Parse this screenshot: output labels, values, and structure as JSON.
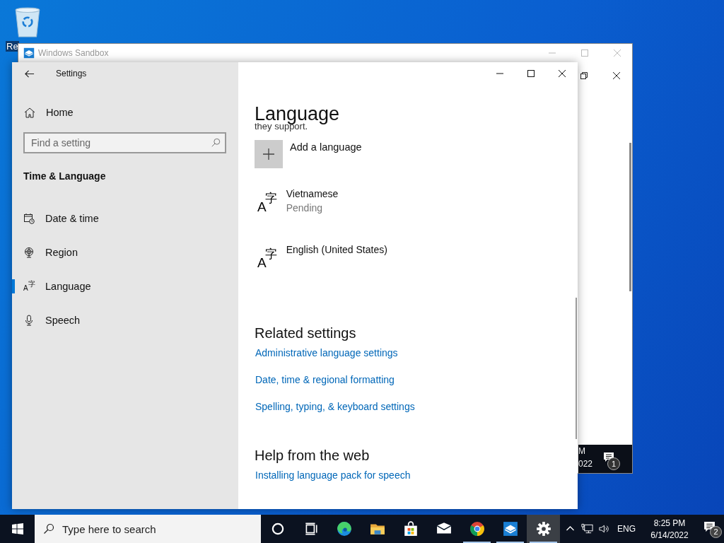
{
  "desktop": {
    "icons": [
      {
        "label": "Re"
      }
    ]
  },
  "sandbox_window": {
    "title": "Windows Sandbox",
    "inner_taskbar": {
      "time": "M",
      "date": "022",
      "notification_count": "1"
    }
  },
  "settings_window": {
    "title": "Settings",
    "sidebar": {
      "home": "Home",
      "search": {
        "placeholder": "Find a setting"
      },
      "section": "Time & Language",
      "items": [
        {
          "label": "Date & time",
          "kind": "clock",
          "selected": false
        },
        {
          "label": "Region",
          "kind": "globe",
          "selected": false
        },
        {
          "label": "Language",
          "kind": "language",
          "selected": true,
          "icon_glyphs": [
            "A",
            "字"
          ]
        },
        {
          "label": "Speech",
          "kind": "mic",
          "selected": false
        }
      ]
    },
    "content": {
      "heading": "Language",
      "clipped_text": "they support.",
      "add_language": "Add a language",
      "languages": [
        {
          "name": "Vietnamese",
          "status": "Pending",
          "icon_glyphs": [
            "A",
            "字"
          ]
        },
        {
          "name": "English (United States)",
          "icon_glyphs": [
            "A",
            "字"
          ]
        }
      ],
      "related_heading": "Related settings",
      "related_links": [
        "Administrative language settings",
        "Date, time & regional formatting",
        "Spelling, typing, & keyboard settings"
      ],
      "help_heading": "Help from the web",
      "help_links": [
        "Installing language pack for speech"
      ]
    }
  },
  "taskbar": {
    "search": {
      "placeholder": "Type here to search"
    },
    "apps": [
      {
        "kind": "cortana",
        "running": false,
        "selected": false
      },
      {
        "kind": "taskview",
        "running": false,
        "selected": false
      },
      {
        "kind": "edge",
        "running": false,
        "selected": false
      },
      {
        "kind": "folder",
        "running": false,
        "selected": false
      },
      {
        "kind": "store",
        "running": false,
        "selected": false
      },
      {
        "kind": "mail",
        "running": false,
        "selected": false
      },
      {
        "kind": "chrome",
        "running": true,
        "selected": false
      },
      {
        "kind": "sandbox",
        "running": true,
        "selected": false
      },
      {
        "kind": "settings",
        "running": true,
        "selected": true
      }
    ],
    "language": "ENG",
    "time": "8:25 PM",
    "date": "6/14/2022",
    "notification_count": "2"
  }
}
